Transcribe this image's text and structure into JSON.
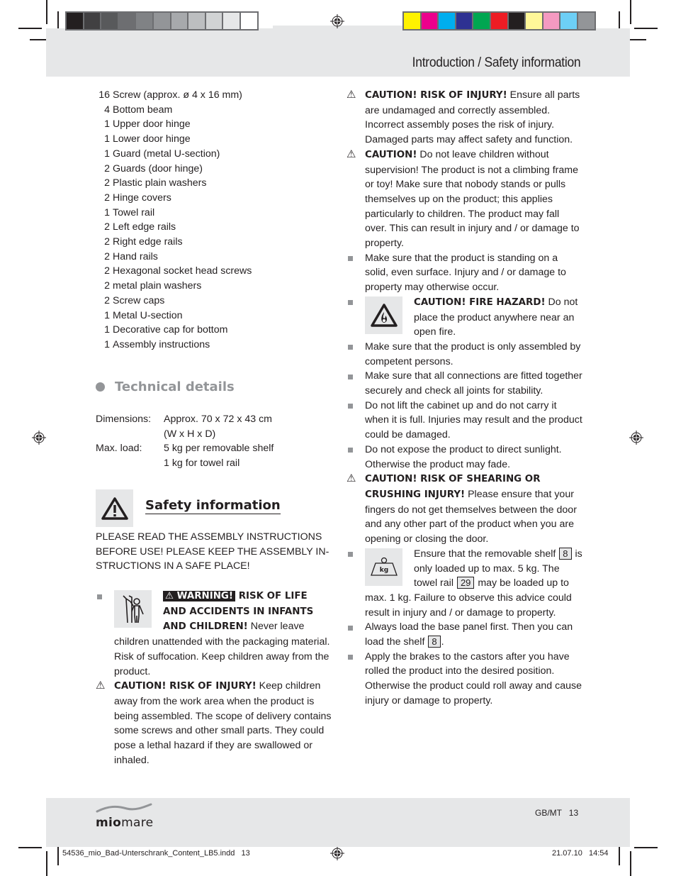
{
  "header": {
    "title": "Introduction / Safety information",
    "grayscale_swatches": [
      "#231f20",
      "#414042",
      "#58595b",
      "#6d6e71",
      "#808285",
      "#939598",
      "#a7a9ac",
      "#bcbec0",
      "#d1d3d4",
      "#e6e7e8",
      "#ffffff"
    ],
    "color_swatches": [
      "#fff200",
      "#ec008c",
      "#00aeef",
      "#2e3192",
      "#00a651",
      "#ed1c24",
      "#231f20",
      "#fff799",
      "#f49ac1",
      "#6dcff6",
      "#939598"
    ]
  },
  "parts_list": [
    {
      "qty": "16",
      "name": "Screw (approx. ø 4 x 16 mm)"
    },
    {
      "qty": "4",
      "name": "Bottom beam"
    },
    {
      "qty": "1",
      "name": "Upper door hinge"
    },
    {
      "qty": "1",
      "name": "Lower door hinge"
    },
    {
      "qty": "1",
      "name": "Guard (metal U-section)"
    },
    {
      "qty": "2",
      "name": "Guards (door hinge)"
    },
    {
      "qty": "2",
      "name": "Plastic plain washers"
    },
    {
      "qty": "2",
      "name": "Hinge covers"
    },
    {
      "qty": "1",
      "name": "Towel rail"
    },
    {
      "qty": "2",
      "name": "Left edge rails"
    },
    {
      "qty": "2",
      "name": "Right edge rails"
    },
    {
      "qty": "2",
      "name": "Hand rails"
    },
    {
      "qty": "2",
      "name": "Hexagonal socket head screws"
    },
    {
      "qty": "2",
      "name": "metal plain washers"
    },
    {
      "qty": "2",
      "name": "Screw caps"
    },
    {
      "qty": "1",
      "name": "Metal U-section"
    },
    {
      "qty": "1",
      "name": "Decorative cap for bottom"
    },
    {
      "qty": "1",
      "name": "Assembly instructions"
    }
  ],
  "technical": {
    "heading": "Technical details",
    "dimensions_label": "Dimensions:",
    "dimensions_value": "Approx. 70 x 72 x 43 cm",
    "dimensions_value_2": "(W x H x D)",
    "max_load_label": "Max. load:",
    "max_load_value": "5 kg per removable shelf",
    "max_load_value_2": "1 kg for towel rail"
  },
  "safety": {
    "heading": "Safety information",
    "intro": "PLEASE READ THE ASSEMBLY INSTRUCTIONS BEFORE USE! PLEASE KEEP THE ASSEMBLY IN-STRUCTIONS IN A SAFE PLACE!",
    "left_items": [
      {
        "marker": "square",
        "icon": "child-icon",
        "warning_label": "WARNING!",
        "bold": "RISK OF LIFE AND ACCIDENTS IN INFANTS AND CHILDREN!",
        "text": " Never leave children unattended with the packaging material. Risk of suffocation. Keep children away from the product."
      },
      {
        "marker": "triangle",
        "bold": "CAUTION! RISK OF INJURY!",
        "text": " Keep children away from the work area when the product is being assembled. The scope of delivery contains some screws and other small parts. They could pose a lethal hazard if they are swallowed or inhaled."
      }
    ],
    "right_items": [
      {
        "marker": "triangle",
        "bold": "CAUTION! RISK OF INJURY!",
        "text": " Ensure all parts are undamaged and correctly assembled. Incorrect assembly poses the risk of injury. Damaged parts may affect safety and function."
      },
      {
        "marker": "triangle",
        "bold": "CAUTION!",
        "text": " Do not leave children without supervision! The product is not a climbing frame or toy! Make sure that nobody stands or pulls themselves up on the product; this applies particularly to children. The product may fall over. This can result in injury and / or damage to property."
      },
      {
        "marker": "square",
        "text": "Make sure that the product is standing on a solid, even surface. Injury and / or damage to property may otherwise occur."
      },
      {
        "marker": "square",
        "icon": "fire-hazard-icon",
        "bold": "CAUTION! FIRE HAZARD!",
        "text": " Do not place the product anywhere near an open fire."
      },
      {
        "marker": "square",
        "text": "Make sure that the product is only assembled by competent persons."
      },
      {
        "marker": "square",
        "text": "Make sure that all connections are fitted together securely and check all joints for stability."
      },
      {
        "marker": "square",
        "text": "Do not lift the cabinet up and do not carry it when it is full. Injuries may result and the product could be damaged."
      },
      {
        "marker": "square",
        "text": "Do not expose the product to direct sunlight. Otherwise the product may fade."
      },
      {
        "marker": "triangle",
        "bold": "CAUTION! RISK OF SHEARING OR CRUSHING INJURY!",
        "text": " Please ensure that your fingers do not get themselves between the door and any other part of the product when you are opening or closing the door."
      },
      {
        "marker": "square",
        "icon": "weight-kg-icon",
        "icon_text": "kg",
        "text_a": "Ensure that the removable shelf ",
        "ref_a": "8",
        "text_b": " is only loaded up to max. 5 kg. The towel rail ",
        "ref_b": "29",
        "text_c": " may be loaded up to max. 1 kg. Failure to observe this advice could result in injury and / or damage to property."
      },
      {
        "marker": "square",
        "text_a": "Always load the base panel first. Then you can load the shelf ",
        "ref_a": "8",
        "text_b": "."
      },
      {
        "marker": "square",
        "text": "Apply the brakes to the castors after you have rolled the product into the desired position. Otherwise the product could roll away and cause injury or damage to property."
      }
    ]
  },
  "footer": {
    "brand_bold": "mio",
    "brand_light": "mare",
    "locale_page": "GB/MT   13",
    "slug_file": "54536_mio_Bad-Unterschrank_Content_LB5.indd   13",
    "slug_date": "21.07.10   14:54"
  }
}
